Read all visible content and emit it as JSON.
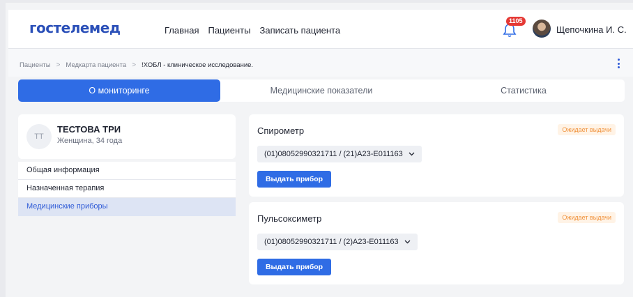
{
  "header": {
    "logo": "гостелемед",
    "nav": [
      "Главная",
      "Пациенты",
      "Записать пациента"
    ],
    "notifications_count": "1105",
    "user_name": "Щепочкина И. С."
  },
  "breadcrumb": {
    "items": [
      "Пациенты",
      "Медкарта пациента",
      "!ХОБЛ - клиническое исследование."
    ],
    "separator": ">"
  },
  "tabs": [
    "О мониторинге",
    "Медицинские показатели",
    "Статистика"
  ],
  "patient": {
    "initials": "ТТ",
    "name": "ТЕСТОВА ТРИ",
    "meta": "Женщина, 34 года"
  },
  "menu": [
    "Общая информация",
    "Назначенная терапия",
    "Медицинские приборы"
  ],
  "devices": [
    {
      "title": "Спирометр",
      "status": "Ожидает выдачи",
      "serial": "(01)08052990321711 / (21)A23-E011163",
      "button": "Выдать прибор"
    },
    {
      "title": "Пульсоксиметр",
      "status": "Ожидает выдачи",
      "serial": "(01)08052990321711 / (2)A23-E011163",
      "button": "Выдать прибор"
    }
  ],
  "colors": {
    "accent": "#2f6ce5",
    "brand": "#2a4fb8",
    "status_text": "#f0913a",
    "badge": "#e53935"
  }
}
